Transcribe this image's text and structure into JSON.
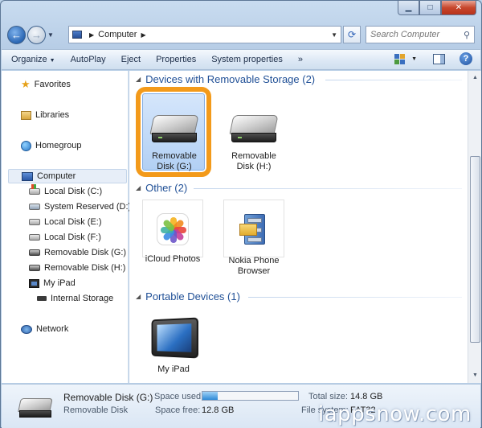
{
  "address": {
    "crumb": "Computer"
  },
  "search": {
    "placeholder": "Search Computer"
  },
  "toolbar": {
    "organize": "Organize",
    "autoplay": "AutoPlay",
    "eject": "Eject",
    "properties": "Properties",
    "system_properties": "System properties",
    "more": "»"
  },
  "nav": {
    "favorites": "Favorites",
    "libraries": "Libraries",
    "homegroup": "Homegroup",
    "computer": "Computer",
    "drives": [
      "Local Disk (C:)",
      "System Reserved (D:)",
      "Local Disk (E:)",
      "Local Disk (F:)",
      "Removable Disk (G:)",
      "Removable Disk (H:)",
      "My iPad"
    ],
    "internal_storage": "Internal Storage",
    "network": "Network"
  },
  "groups": {
    "removable": "Devices with Removable Storage (2)",
    "other": "Other (2)",
    "portable": "Portable Devices (1)"
  },
  "items": {
    "disk_g": {
      "line1": "Removable",
      "line2": "Disk (G:)"
    },
    "disk_h": {
      "line1": "Removable",
      "line2": "Disk (H:)"
    },
    "icloud": {
      "line1": "iCloud Photos"
    },
    "nokia": {
      "line1": "Nokia Phone",
      "line2": "Browser"
    },
    "ipad": {
      "line1": "My iPad"
    }
  },
  "status": {
    "name": "Removable Disk (G:)",
    "type": "Removable Disk",
    "space_used_label": "Space used:",
    "space_used_fraction": 0.16,
    "space_free_label": "Space free:",
    "space_free_value": "12.8 GB",
    "total_size_label": "Total size:",
    "total_size_value": "14.8 GB",
    "filesystem_label": "File system:",
    "filesystem_value": "FAT32"
  },
  "watermark": "iappsnow.com",
  "colors": {
    "highlight": "#f39a1a",
    "group_header": "#1f4f96"
  }
}
